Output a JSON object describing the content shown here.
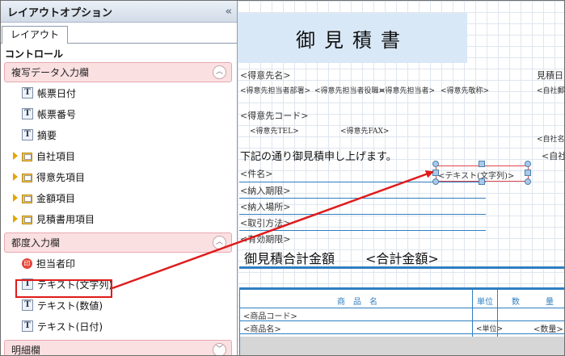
{
  "panel": {
    "title": "レイアウトオプション",
    "collapse_glyph": "«",
    "tab": "レイアウト",
    "controls_label": "コントロール",
    "groups": [
      {
        "label": "複写データ入力欄",
        "toggle": "︿",
        "items": [
          "帳票日付",
          "帳票番号",
          "摘要"
        ],
        "folders": [
          "自社項目",
          "得意先項目",
          "金額項目",
          "見積書用項目"
        ]
      },
      {
        "label": "都度入力欄",
        "toggle": "︿",
        "items": [
          "担当者印",
          "テキスト(文字列)",
          "テキスト(数値)",
          "テキスト(日付)"
        ]
      },
      {
        "label": "明細欄",
        "toggle": "﹀"
      }
    ],
    "seal_glyph": "印",
    "t_glyph": "T"
  },
  "canvas": {
    "title": "御見積書",
    "customer_name": "<得意先名>",
    "customer_details": [
      "<得意先担当者部署>",
      "<得意先担当者役職>",
      "<得意先担当者>",
      "<得意先敬称>"
    ],
    "customer_code": "<得意先コード>",
    "customer_tel": "<得意先TEL>",
    "customer_fax": "<得意先FAX>",
    "right_top": "見積日",
    "right_company": "<自社郵",
    "right_company2": "<自社名",
    "right_company3": "<自社",
    "intro": "下記の通り御見積申し上げます。",
    "fields": [
      "<件名>",
      "<納入期限>",
      "<納入場所>",
      "<取引方法>",
      "<有効期限>"
    ],
    "selected_field": "<テキスト(文字列)>",
    "total_label": "御見積合計金額",
    "total_value": "<合計金額>",
    "table_headers": [
      "商　品　名",
      "単位",
      "数",
      "量"
    ],
    "table_row1": "<商品コード>",
    "table_row2": "<商品名>",
    "table_row2_unit": "<単位>",
    "table_row2_qty": "<数量>"
  },
  "colors": {
    "accent_blue": "#2f7fc1",
    "highlight_red": "#e01b1b",
    "group_header_bg": "#fbe0e2",
    "title_block_bg": "#d9e8f7"
  }
}
